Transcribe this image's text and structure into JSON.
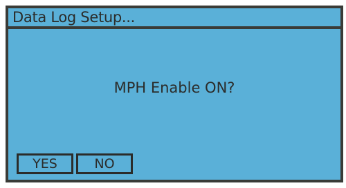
{
  "title": "Data Log Setup...",
  "prompt": "MPH Enable ON?",
  "softkeys": {
    "yes_label": "YES",
    "no_label": "NO"
  },
  "colors": {
    "screen_background": "#5ab0d8",
    "border": "#3a3b37",
    "text": "#2b2c2a"
  }
}
